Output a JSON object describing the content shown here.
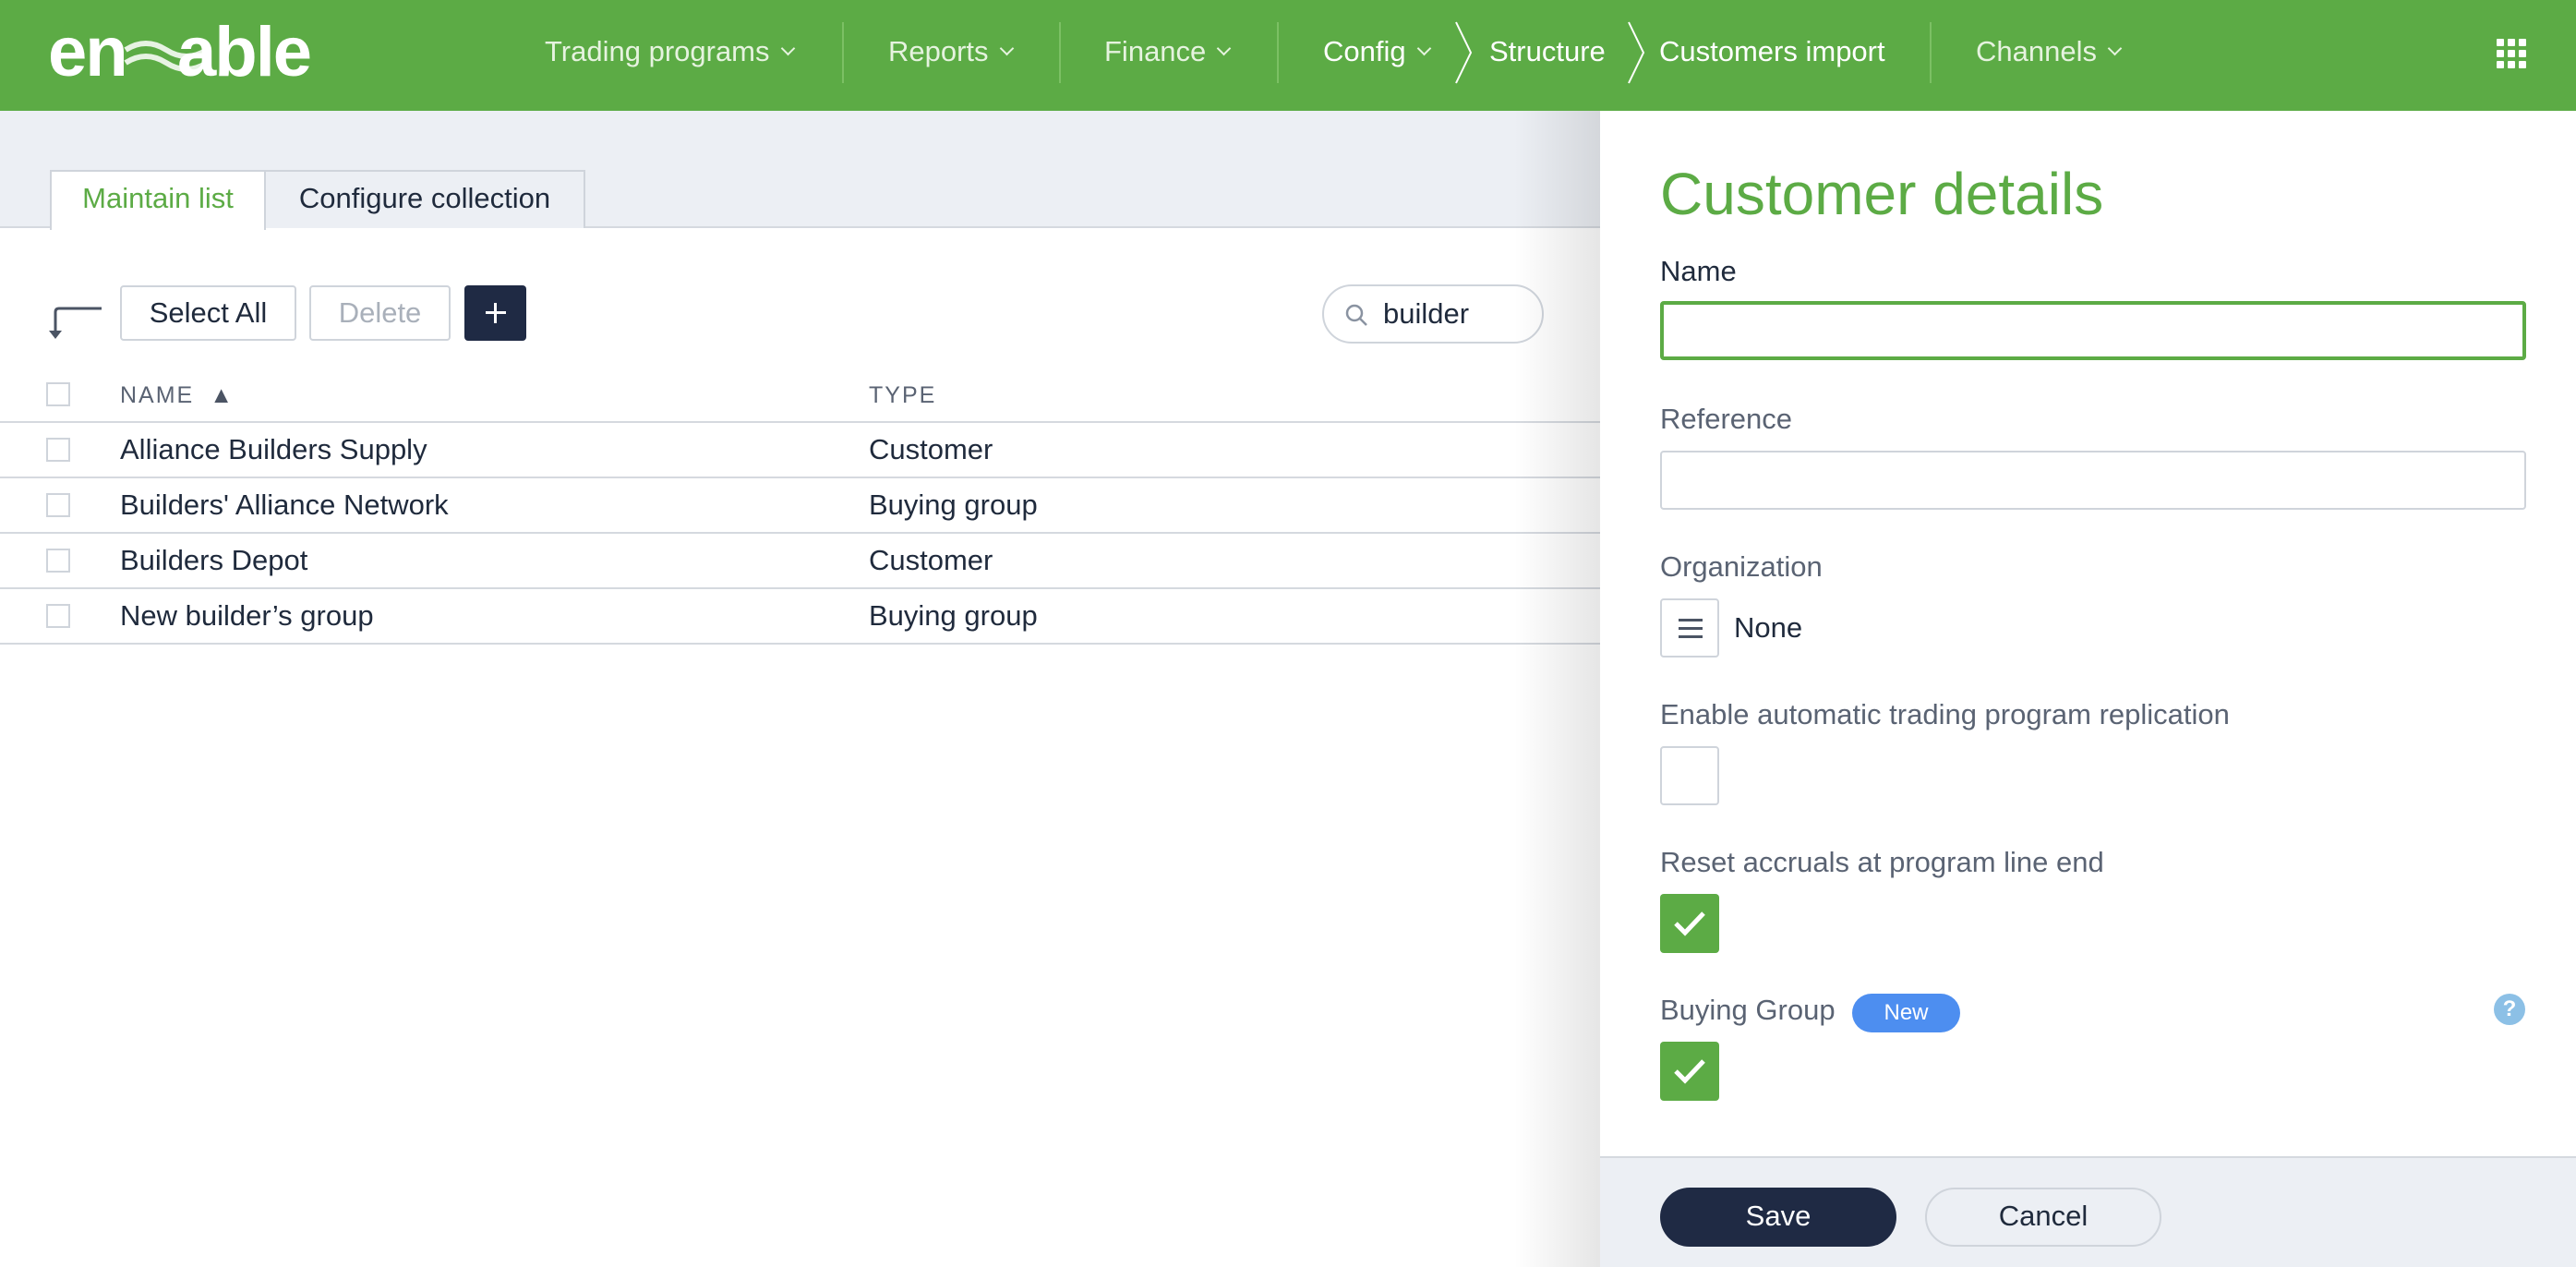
{
  "app": {
    "logo_text": "enable",
    "brand_color": "#5cab45",
    "dark_color": "#1f2a44"
  },
  "nav": {
    "items": [
      {
        "label": "Trading programs"
      },
      {
        "label": "Reports"
      },
      {
        "label": "Finance"
      },
      {
        "label": "Config"
      },
      {
        "label": "Channels"
      }
    ],
    "breadcrumb": [
      "Structure",
      "Customers import"
    ]
  },
  "tabs": [
    {
      "label": "Maintain list",
      "active": true
    },
    {
      "label": "Configure collection",
      "active": false
    }
  ],
  "toolbar": {
    "select_all": "Select All",
    "delete": "Delete"
  },
  "search": {
    "value": "builder"
  },
  "table": {
    "columns": [
      "NAME",
      "TYPE"
    ],
    "sort_indicator": "▲",
    "rows": [
      {
        "name": "Alliance Builders Supply",
        "type": "Customer"
      },
      {
        "name": "Builders' Alliance Network",
        "type": "Buying group"
      },
      {
        "name": "Builders Depot",
        "type": "Customer"
      },
      {
        "name": "New builder’s group",
        "type": "Buying group"
      }
    ]
  },
  "panel": {
    "title": "Customer details",
    "name_label": "Name",
    "name_value": "",
    "reference_label": "Reference",
    "reference_value": "",
    "organization_label": "Organization",
    "organization_value": "None",
    "auto_replication_label": "Enable automatic trading program replication",
    "auto_replication_checked": false,
    "reset_accruals_label": "Reset accruals at program line end",
    "reset_accruals_checked": true,
    "buying_group_label": "Buying Group",
    "buying_group_badge": "New",
    "buying_group_checked": true,
    "help_symbol": "?",
    "save_label": "Save",
    "cancel_label": "Cancel"
  }
}
